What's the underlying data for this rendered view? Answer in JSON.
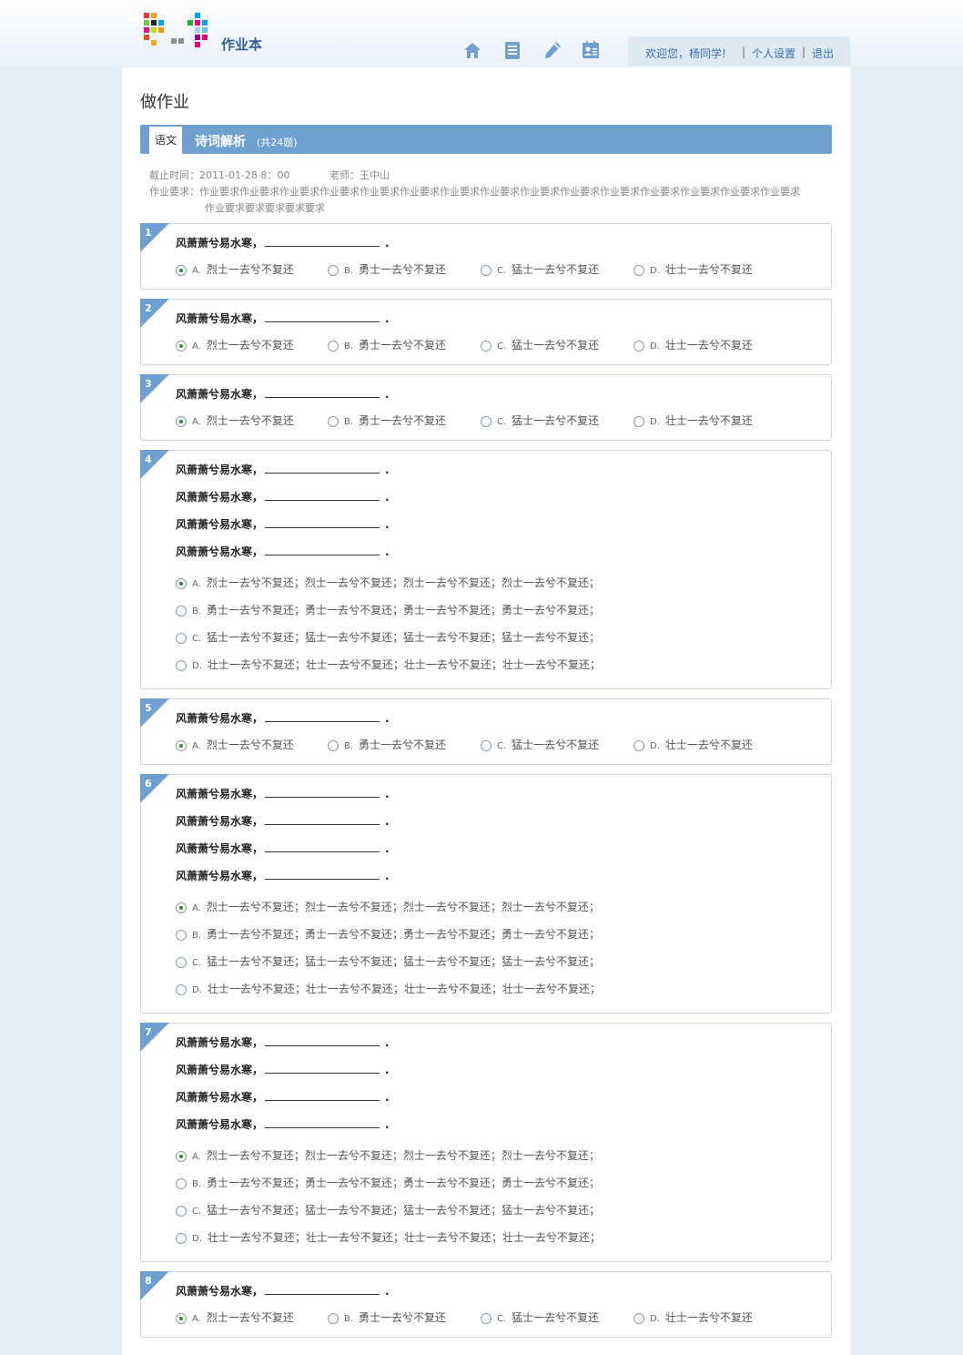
{
  "app": {
    "name": "作业本"
  },
  "nav_icons": [
    "home-icon",
    "notebook-icon",
    "pen-icon",
    "contacts-icon"
  ],
  "user": {
    "greeting": "欢迎您，杨同学!",
    "settings": "个人设置",
    "logout": "退出",
    "sep": "|"
  },
  "page": {
    "title": "做作业"
  },
  "subject": {
    "tag": "语文",
    "name": "诗词解析",
    "count": "(共24题)"
  },
  "meta": {
    "deadline_label": "截止时间：",
    "deadline_value": "2011-01-28 8：00",
    "teacher_label": "老师：",
    "teacher_value": "王中山",
    "req_label": "作业要求：",
    "req_line1": "作业要求作业要求作业要求作业要求作业要求作业要求作业要求作业要求作业要求作业要求作业要求作业要求作业要求作业要求作业要求",
    "req_line2": "作业要求要求要求要求要求"
  },
  "question_stem": "风萧萧兮易水寒，",
  "options_short": [
    {
      "letter": "A.",
      "text": "烈士一去兮不复还"
    },
    {
      "letter": "B.",
      "text": "勇士一去兮不复还"
    },
    {
      "letter": "C.",
      "text": "猛士一去兮不复还"
    },
    {
      "letter": "D.",
      "text": "壮士一去兮不复还"
    }
  ],
  "options_long": [
    {
      "letter": "A.",
      "text": "烈士一去兮不复还；烈士一去兮不复还；烈士一去兮不复还；烈士一去兮不复还；"
    },
    {
      "letter": "B.",
      "text": "勇士一去兮不复还；勇士一去兮不复还；勇士一去兮不复还；勇士一去兮不复还；"
    },
    {
      "letter": "C.",
      "text": "猛士一去兮不复还；猛士一去兮不复还；猛士一去兮不复还；猛士一去兮不复还；"
    },
    {
      "letter": "D.",
      "text": "壮士一去兮不复还；壮士一去兮不复还；壮士一去兮不复还；壮士一去兮不复还；"
    }
  ],
  "questions": [
    {
      "num": "1",
      "type": "short",
      "selected": "A"
    },
    {
      "num": "2",
      "type": "short",
      "selected": "A"
    },
    {
      "num": "3",
      "type": "short",
      "selected": "A"
    },
    {
      "num": "4",
      "type": "long",
      "selected": "A"
    },
    {
      "num": "5",
      "type": "short",
      "selected": "A"
    },
    {
      "num": "6",
      "type": "long",
      "selected": "A"
    },
    {
      "num": "7",
      "type": "long",
      "selected": "A"
    },
    {
      "num": "8",
      "type": "short",
      "selected": "A"
    }
  ]
}
